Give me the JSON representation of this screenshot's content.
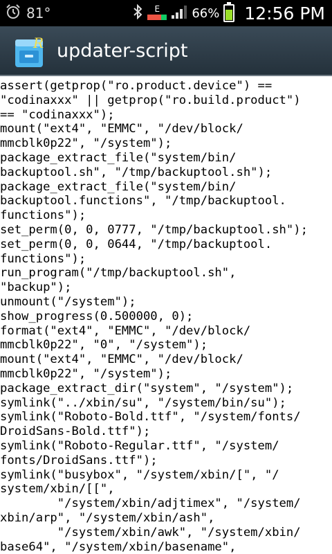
{
  "status_bar": {
    "temperature": "81°",
    "battery_percent": "66%",
    "battery_level": 0.66,
    "network_type": "E",
    "time": "12:56 PM"
  },
  "app_bar": {
    "title": "updater-script",
    "icon": "folder-cabinet-icon"
  },
  "content": {
    "lines": [
      "assert(getprop(\"ro.product.device\") ==",
      "\"codinaxxx\" || getprop(\"ro.build.product\")",
      "== \"codinaxxx\");",
      "mount(\"ext4\", \"EMMC\", \"/dev/block/",
      "mmcblk0p22\", \"/system\");",
      "package_extract_file(\"system/bin/",
      "backuptool.sh\", \"/tmp/backuptool.sh\");",
      "package_extract_file(\"system/bin/",
      "backuptool.functions\", \"/tmp/backuptool.",
      "functions\");",
      "set_perm(0, 0, 0777, \"/tmp/backuptool.sh\");",
      "set_perm(0, 0, 0644, \"/tmp/backuptool.",
      "functions\");",
      "run_program(\"/tmp/backuptool.sh\",",
      "\"backup\");",
      "unmount(\"/system\");",
      "show_progress(0.500000, 0);",
      "format(\"ext4\", \"EMMC\", \"/dev/block/",
      "mmcblk0p22\", \"0\", \"/system\");",
      "mount(\"ext4\", \"EMMC\", \"/dev/block/",
      "mmcblk0p22\", \"/system\");",
      "package_extract_dir(\"system\", \"/system\");",
      "symlink(\"../xbin/su\", \"/system/bin/su\");",
      "symlink(\"Roboto-Bold.ttf\", \"/system/fonts/",
      "DroidSans-Bold.ttf\");",
      "symlink(\"Roboto-Regular.ttf\", \"/system/",
      "fonts/DroidSans.ttf\");",
      "symlink(\"busybox\", \"/system/xbin/[\", \"/",
      "system/xbin/[[\",",
      "        \"/system/xbin/adjtimex\", \"/system/",
      "xbin/arp\", \"/system/xbin/ash\",",
      "        \"/system/xbin/awk\", \"/system/xbin/",
      "base64\", \"/system/xbin/basename\","
    ]
  }
}
